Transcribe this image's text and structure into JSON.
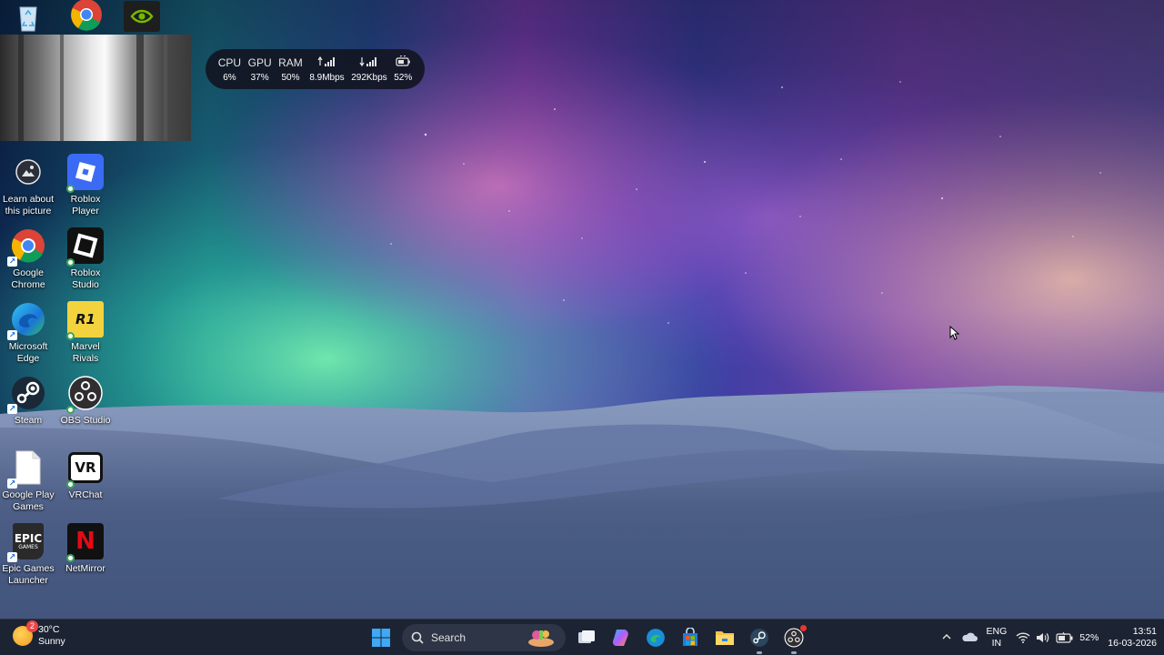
{
  "desktop": {
    "partial_icons": [
      {
        "name": "recycle-bin-icon"
      },
      {
        "name": "chrome-icon"
      },
      {
        "name": "nvidia-icon"
      }
    ],
    "icons": [
      {
        "label": "Learn about this picture",
        "icon": "learn-about-picture-icon"
      },
      {
        "label": "Roblox Player",
        "icon": "roblox-player-icon"
      },
      {
        "label": "Google Chrome",
        "icon": "chrome-icon"
      },
      {
        "label": "Roblox Studio",
        "icon": "roblox-studio-icon"
      },
      {
        "label": "Microsoft Edge",
        "icon": "edge-icon"
      },
      {
        "label": "Marvel Rivals",
        "icon": "marvel-rivals-icon"
      },
      {
        "label": "Steam",
        "icon": "steam-icon"
      },
      {
        "label": "OBS Studio",
        "icon": "obs-icon"
      },
      {
        "label": "Google Play Games",
        "icon": "file-icon"
      },
      {
        "label": "VRChat",
        "icon": "vrchat-icon"
      },
      {
        "label": "Epic Games Launcher",
        "icon": "epic-games-icon"
      },
      {
        "label": "NetMirror",
        "icon": "netmirror-icon"
      }
    ]
  },
  "sysmon": {
    "cpu_label": "CPU",
    "cpu_value": "6%",
    "gpu_label": "GPU",
    "gpu_value": "37%",
    "ram_label": "RAM",
    "ram_value": "50%",
    "upload_icon": "upload-signal-icon",
    "upload_value": "8.9Mbps",
    "download_icon": "download-signal-icon",
    "download_value": "292Kbps",
    "battery_icon": "battery-icon",
    "battery_value": "52%"
  },
  "taskbar": {
    "weather": {
      "temp": "30°C",
      "condition": "Sunny",
      "badge": "2",
      "icon": "sun-icon"
    },
    "search_placeholder": "Search",
    "pinned": [
      {
        "icon": "start-icon"
      },
      {
        "icon": "task-view-icon"
      },
      {
        "icon": "copilot-icon"
      },
      {
        "icon": "edge-icon"
      },
      {
        "icon": "store-icon"
      },
      {
        "icon": "file-explorer-icon"
      },
      {
        "icon": "steam-icon"
      },
      {
        "icon": "obs-icon"
      }
    ],
    "tray": {
      "lang_1": "ENG",
      "lang_2": "IN",
      "battery_percent": "52%",
      "time": "13:51",
      "date": "16-03-2026"
    }
  },
  "colors": {
    "taskbar_bg": "#1c2433",
    "widget_bg": "#121622",
    "accent": "#0078d4"
  }
}
